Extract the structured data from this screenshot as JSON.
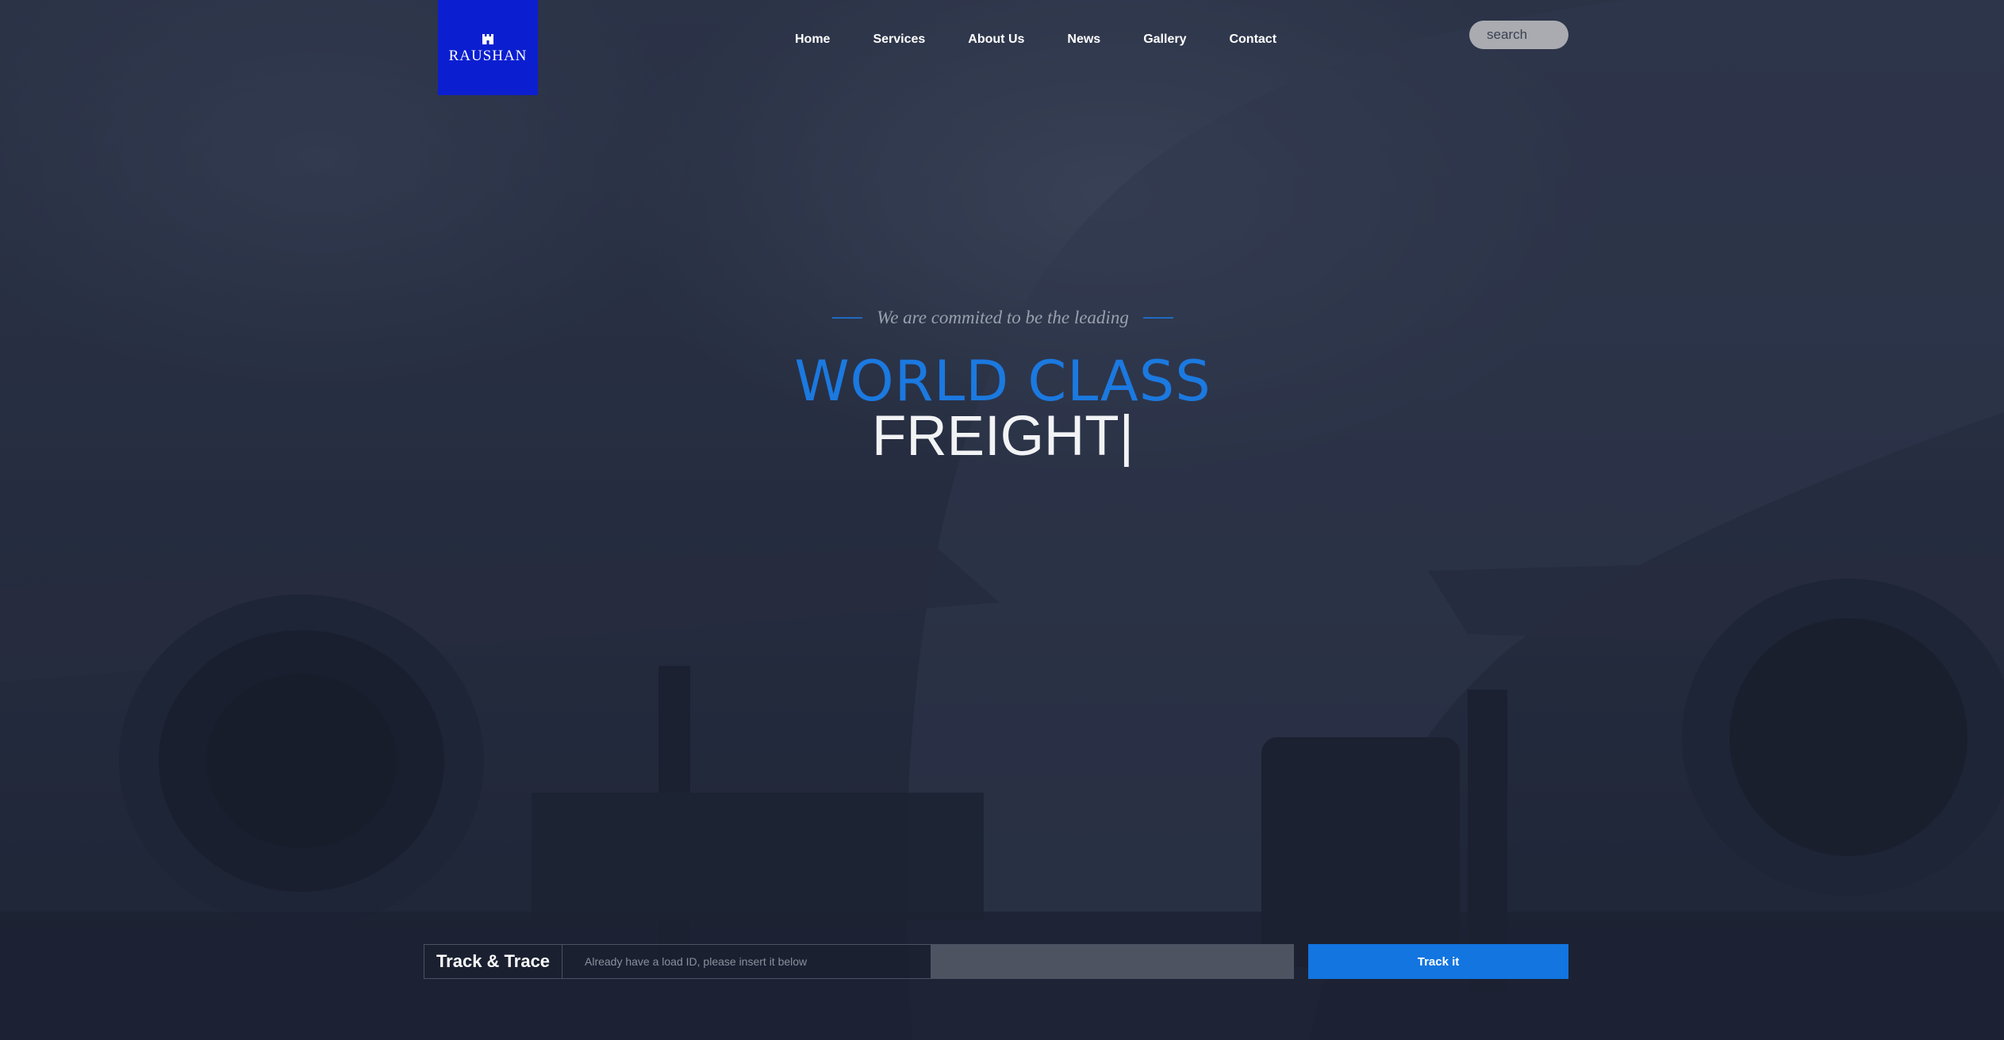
{
  "brand": {
    "name": "RAUSHAN",
    "logo_icon": "castle-icon",
    "logo_bg": "#0b1fd0"
  },
  "nav": {
    "items": [
      "Home",
      "Services",
      "About Us",
      "News",
      "Gallery",
      "Contact"
    ]
  },
  "search": {
    "placeholder": "search"
  },
  "hero": {
    "tagline": "We are commited to be the leading",
    "headline_accent": "WORLD CLASS",
    "headline_main": "FREIGHT",
    "caret": "|",
    "accent_color": "#1b79e0"
  },
  "track": {
    "label": "Track & Trace",
    "hint": "Already have a load ID, please insert it below",
    "input_value": "",
    "button_label": "Track it",
    "button_color": "#1375e0"
  }
}
